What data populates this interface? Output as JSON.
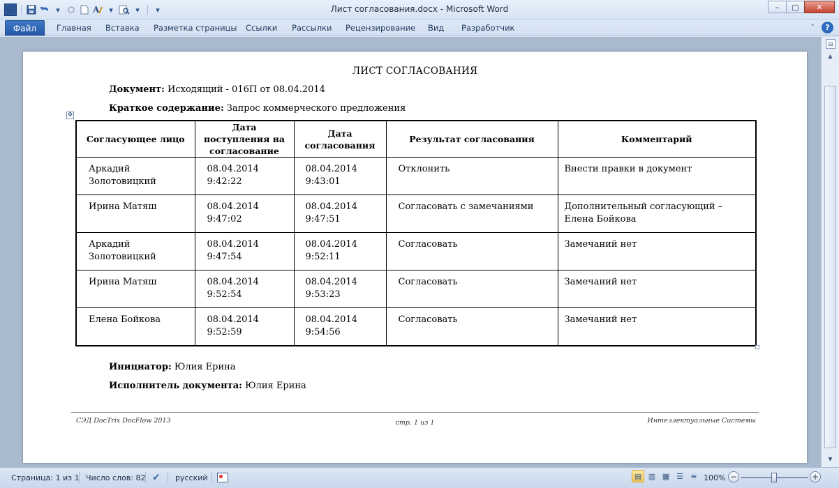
{
  "window": {
    "title": "Лист согласования.docx - Microsoft Word",
    "app_icon": "W",
    "controls": {
      "minimize": "–",
      "maximize": "▢",
      "close": "✕"
    }
  },
  "qat": {
    "icons": [
      "word-logo-icon",
      "save-icon",
      "undo-icon",
      "redo-icon",
      "new-document-icon",
      "text-style-icon",
      "print-preview-icon",
      "customize-qat-icon"
    ]
  },
  "ribbon": {
    "file_tab": "Файл",
    "tabs": [
      "Главная",
      "Вставка",
      "Разметка страницы",
      "Ссылки",
      "Рассылки",
      "Рецензирование",
      "Вид",
      "Разработчик"
    ],
    "help": "?",
    "minimize_ribbon": "˅"
  },
  "document": {
    "title": "ЛИСТ СОГЛАСОВАНИЯ",
    "doc_label": "Документ:",
    "doc_value": " Исходящий  - 016П от 08.04.2014",
    "summary_label": "Краткое содержание:",
    "summary_value": " Запрос коммерческого  предложения",
    "table": {
      "headers": [
        "Согласующее лицо",
        "Дата поступления на согласование",
        "Дата согласования",
        "Результат согласования",
        "Комментарий"
      ],
      "rows": [
        {
          "person": "Аркадий Золотовицкий",
          "received": "08.04.2014",
          "received_time": "9:42:22",
          "approved": "08.04.2014",
          "approved_time": "9:43:01",
          "result": "Отклонить",
          "comment": "Внести правки в документ"
        },
        {
          "person": "Ирина Матяш",
          "received": "08.04.2014",
          "received_time": "9:47:02",
          "approved": "08.04.2014",
          "approved_time": "9:47:51",
          "result": "Согласовать с замечаниями",
          "comment": "Дополнительный согласующий – Елена Бойкова"
        },
        {
          "person": "Аркадий Золотовицкий",
          "received": "08.04.2014",
          "received_time": "9:47:54",
          "approved": "08.04.2014",
          "approved_time": "9:52:11",
          "result": "Согласовать",
          "comment": "Замечаний нет"
        },
        {
          "person": "Ирина Матяш",
          "received": "08.04.2014",
          "received_time": "9:52:54",
          "approved": "08.04.2014",
          "approved_time": "9:53:23",
          "result": "Согласовать",
          "comment": "Замечаний нет"
        },
        {
          "person": "Елена Бойкова",
          "received": "08.04.2014",
          "received_time": "9:52:59",
          "approved": "08.04.2014",
          "approved_time": "9:54:56",
          "result": "Согласовать",
          "comment": "Замечаний нет"
        }
      ]
    },
    "initiator_label": "Инициатор:",
    "initiator_value": "  Юлия Ерина",
    "executor_label": "Исполнитель документа:",
    "executor_value": " Юлия Ерина",
    "footer": {
      "left": "СЭД DocTrix DocFlow 2013",
      "center": "стр. 1 из 1",
      "right": "Интеллектуальные Системы"
    }
  },
  "statusbar": {
    "page": "Страница: 1 из 1",
    "words": "Число слов: 82",
    "language": "русский",
    "zoom": "100%",
    "zoom_minus": "−",
    "zoom_plus": "+"
  }
}
